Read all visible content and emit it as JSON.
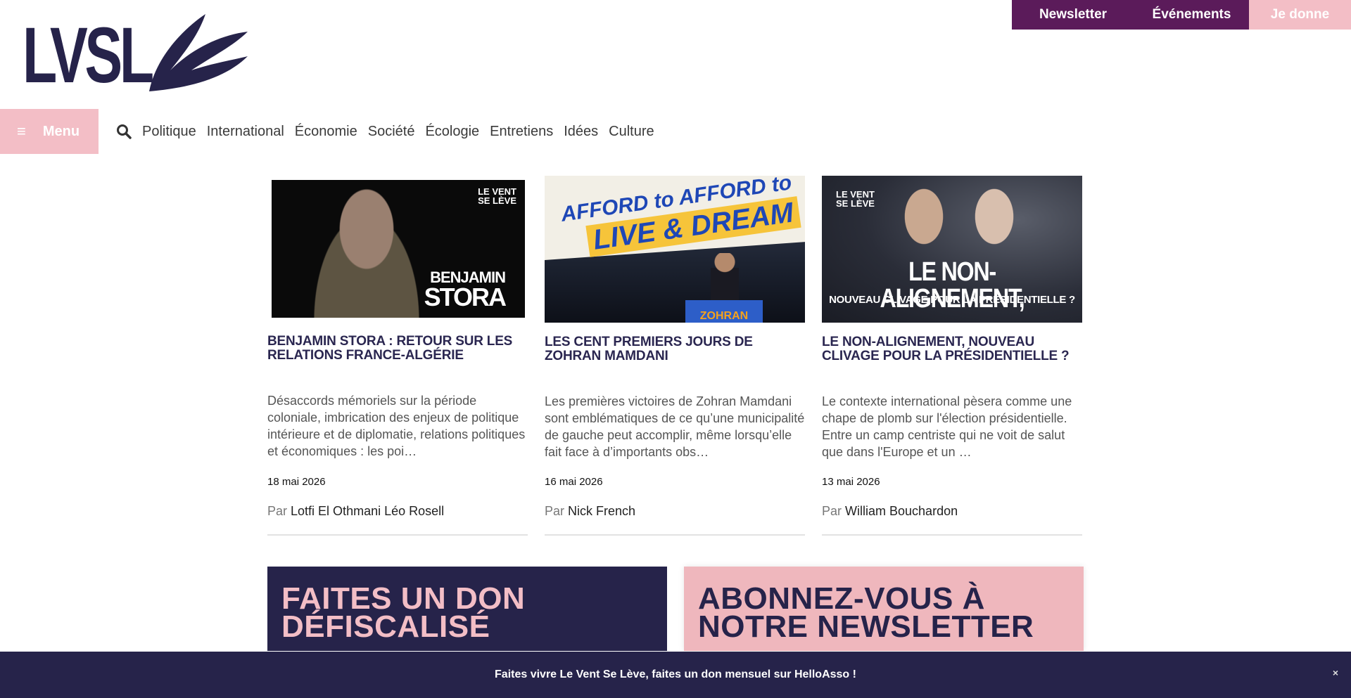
{
  "topbar": {
    "newsletter": "Newsletter",
    "events": "Événements",
    "give": "Je donne"
  },
  "logo": {
    "text": "LVSL"
  },
  "nav": {
    "menu_label": "Menu",
    "links": [
      "Politique",
      "International",
      "Économie",
      "Société",
      "Écologie",
      "Entretiens",
      "Idées",
      "Culture"
    ]
  },
  "articles": [
    {
      "title": "BENJAMIN STORA : RETOUR SUR LES RELATIONS FRANCE-ALGÉRIE",
      "excerpt": "Désaccords mémoriels sur la  période coloniale, imbrication des enjeux de politique intérieure et de diplomatie, relations politiques et économiques : les poi…",
      "date": "18 mai 2026",
      "by": "Par",
      "author": "Lotfi El Othmani Léo Rosell",
      "thumb": {
        "brand": "LE VENT SE LÈVE",
        "name_first": "BENJAMIN",
        "name_last": "STORA"
      }
    },
    {
      "title": "LES CENT PREMIERS JOURS DE ZOHRAN MAMDANI",
      "excerpt": "Les premières victoires de Zohran Mamdani sont emblématiques de ce qu’une municipalité de gauche peut accomplir, même lorsqu’elle fait face à d’importants obs…",
      "date": "16 mai 2026",
      "by": "Par",
      "author": "Nick French",
      "thumb": {
        "banner_line1": "AFFORD to AFFORD to",
        "banner_line2": "LIVE & DREAM",
        "podium": "ZOHRAN"
      }
    },
    {
      "title": "LE NON-ALIGNEMENT, NOUVEAU CLIVAGE POUR LA PRÉSIDENTIELLE ?",
      "excerpt": "Le contexte international pèsera comme une chape de plomb sur l'élection présidentielle. Entre un camp centriste qui ne voit de salut que dans l'Europe et un …",
      "date": "13 mai 2026",
      "by": "Par",
      "author": "William Bouchardon",
      "thumb": {
        "brand": "LE VENT SE LÈVE",
        "headline": "LE NON-ALIGNEMENT,",
        "sub": "NOUVEAU CLIVAGE POUR LA PRÉSIDENTIELLE ?"
      }
    }
  ],
  "promos": {
    "don": "FAITES UN DON DÉFISCALISÉ",
    "newsletter": "ABONNEZ-VOUS À NOTRE NEWSLETTER"
  },
  "sticky": {
    "text": "Faites vivre Le Vent Se Lève, faites un don mensuel sur HelloAsso !",
    "close": "×"
  },
  "colors": {
    "navy": "#26234a",
    "plum": "#5b1b5a",
    "pink": "#f3bec6"
  }
}
